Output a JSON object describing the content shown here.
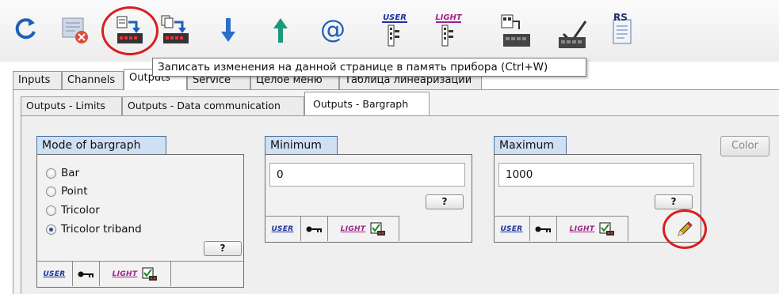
{
  "toolbar": {
    "icons": [
      "refresh-icon",
      "discard-changes-icon",
      "write-page-to-device-icon",
      "write-all-to-device-icon",
      "download-icon",
      "upload-icon",
      "email-icon",
      "user-menu-icon",
      "light-menu-icon",
      "device-config-icon",
      "device-settings-icon",
      "rs-document-icon"
    ],
    "user_label": "USER",
    "light_label": "LIGHT",
    "rs_label": "RS"
  },
  "tooltip": "Записать изменения на данной странице в память прибора (Ctrl+W)",
  "tabs": [
    {
      "label": "Inputs"
    },
    {
      "label": "Channels"
    },
    {
      "label": "Outputs"
    },
    {
      "label": "Service"
    },
    {
      "label": "Целое меню"
    },
    {
      "label": "Таблица линеаризации"
    }
  ],
  "subtabs": [
    {
      "label": "Outputs - Limits"
    },
    {
      "label": "Outputs - Data communication"
    },
    {
      "label": "Outputs - Bargraph"
    }
  ],
  "mode_group": {
    "title": "Mode of bargraph",
    "options": [
      {
        "label": "Bar",
        "checked": false
      },
      {
        "label": "Point",
        "checked": false
      },
      {
        "label": "Tricolor",
        "checked": false
      },
      {
        "label": "Tricolor triband",
        "checked": true
      }
    ],
    "help_label": "?",
    "user_label": "USER",
    "light_label": "LIGHT"
  },
  "minimum_group": {
    "title": "Minimum",
    "value": "0",
    "help_label": "?",
    "user_label": "USER",
    "light_label": "LIGHT"
  },
  "maximum_group": {
    "title": "Maximum",
    "value": "1000",
    "help_label": "?",
    "user_label": "USER",
    "light_label": "LIGHT"
  },
  "color_button": "Color",
  "colors": {
    "user": "#1a2fa0",
    "light": "#a0208a",
    "highlight": "#d81e1e",
    "group_title_bg": "#cfe0f4"
  }
}
